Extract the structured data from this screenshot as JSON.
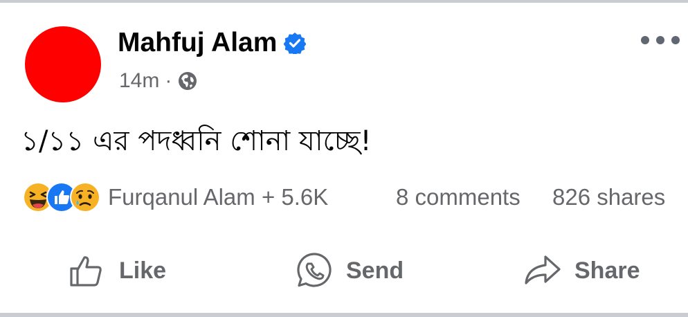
{
  "post": {
    "author": "Mahfuj Alam",
    "verified_icon": "verified-badge-icon",
    "time": "14m",
    "separator": "·",
    "audience_icon": "globe-icon",
    "text": "১/১১ এর পদধ্বনি শোনা যাচ্ছে!",
    "avatar_color": "#ff0000"
  },
  "reactions": {
    "icons": [
      "haha-icon",
      "like-icon",
      "sad-icon"
    ],
    "summary": "Furqanul Alam + 5.6K",
    "comments": "8 comments",
    "shares": "826 shares"
  },
  "actions": {
    "like": "Like",
    "send": "Send",
    "share": "Share"
  },
  "colors": {
    "verified_blue": "#1877f2",
    "secondary_text": "#65676b",
    "divider": "#c9ccd1"
  }
}
